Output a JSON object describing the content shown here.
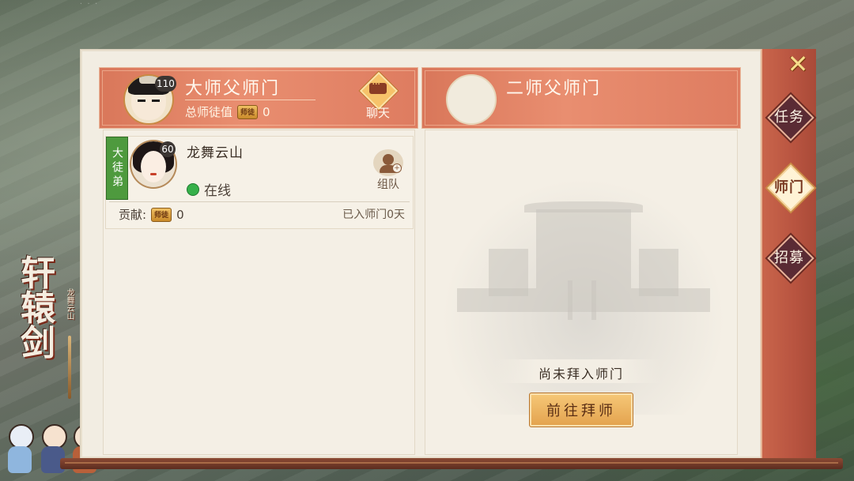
{
  "logo": {
    "main": "轩辕剑",
    "sub": "龙舞云山"
  },
  "close_label": "✕",
  "rail_tabs": [
    {
      "label": "任务",
      "active": false
    },
    {
      "label": "师门",
      "active": true
    },
    {
      "label": "招募",
      "active": false
    }
  ],
  "master1": {
    "title": "大师父师门",
    "level": "110",
    "total_label": "总师徒值",
    "coin_icon_text": "师徒",
    "total_value": "0",
    "chat_label": "聊天"
  },
  "master2": {
    "title": "二师父师门",
    "empty_text": "尚未拜入师门",
    "go_button": "前往拜师"
  },
  "disciple": {
    "rank_tag": "大徒弟",
    "level": "60",
    "name": "龙舞云山",
    "status": "在线",
    "team_label": "组队",
    "contrib_label": "贡献:",
    "coin_icon_text": "师徒",
    "contrib_value": "0",
    "joined": "已入师门0天"
  },
  "colors": {
    "header_bg": "#e98e70",
    "rail_bg": "#b85440",
    "online_dot": "#36b04a",
    "tag_green": "#4e9a3e",
    "button_gold": "#f6c878"
  }
}
